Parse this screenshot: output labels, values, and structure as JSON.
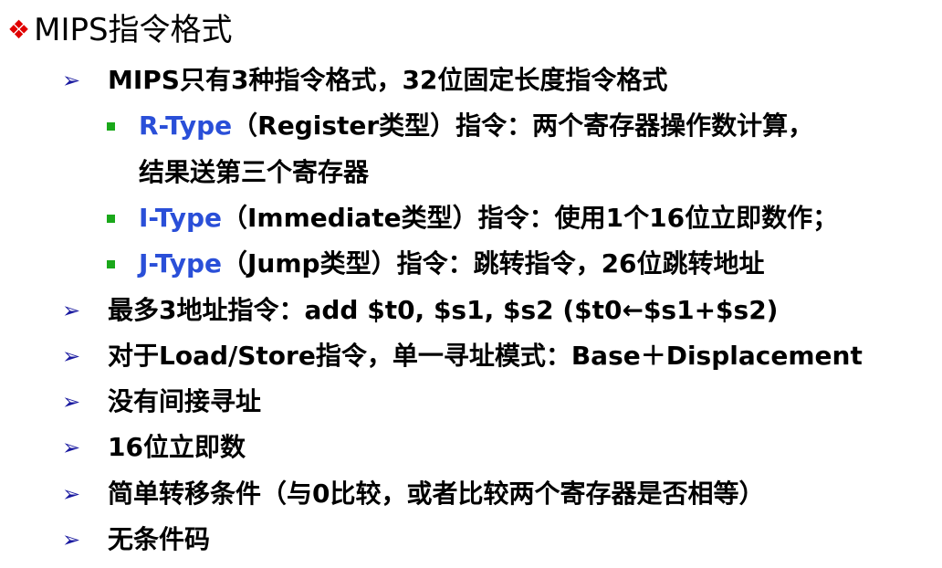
{
  "title": {
    "bullet": "❖",
    "text": "MIPS指令格式"
  },
  "items": [
    {
      "level": 1,
      "marker": "➢",
      "parts": [
        {
          "text": "MIPS只有3种指令格式，32位固定长度指令格式"
        }
      ]
    },
    {
      "level": 2,
      "marker": "■",
      "parts": [
        {
          "text": "R-Type",
          "color": "#2a4fd8"
        },
        {
          "text": "（Register类型）指令：两个寄存器操作数计算，"
        }
      ]
    },
    {
      "level": 3,
      "parts": [
        {
          "text": "结果送第三个寄存器"
        }
      ]
    },
    {
      "level": 2,
      "marker": "■",
      "parts": [
        {
          "text": "I-Type",
          "color": "#2a4fd8"
        },
        {
          "text": "（Immediate类型）指令：使用1个16位立即数作；"
        }
      ]
    },
    {
      "level": 2,
      "marker": "■",
      "parts": [
        {
          "text": "J-Type",
          "color": "#2a4fd8"
        },
        {
          "text": "（Jump类型）指令：跳转指令，26位跳转地址"
        }
      ]
    },
    {
      "level": 1,
      "marker": "➢",
      "parts": [
        {
          "text": "最多3地址指令：add  $t0, $s1, $s2  ($t0←$s1+$s2)"
        }
      ]
    },
    {
      "level": 1,
      "marker": "➢",
      "parts": [
        {
          "text": "对于Load/Store指令，单一寻址模式：Base＋Displacement"
        }
      ]
    },
    {
      "level": 1,
      "marker": "➢",
      "parts": [
        {
          "text": "没有间接寻址"
        }
      ]
    },
    {
      "level": 1,
      "marker": "➢",
      "parts": [
        {
          "text": "16位立即数"
        }
      ]
    },
    {
      "level": 1,
      "marker": "➢",
      "parts": [
        {
          "text": "简单转移条件（与0比较，或者比较两个寄存器是否相等）"
        }
      ]
    },
    {
      "level": 1,
      "marker": "➢",
      "parts": [
        {
          "text": "无条件码"
        }
      ]
    }
  ],
  "colors": {
    "title_bullet": "#e00000",
    "arrow": "#1a1aa0",
    "square": "#1aa81a",
    "type_label": "#2a4fd8",
    "text": "#000000"
  }
}
